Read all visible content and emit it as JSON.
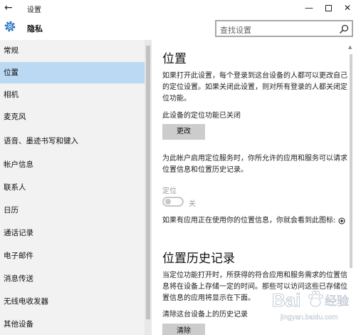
{
  "window": {
    "back_glyph": "←",
    "title": "设置",
    "minimize_glyph": "—",
    "close_glyph": "✕"
  },
  "header": {
    "title": "隐私",
    "search_placeholder": "查找设置"
  },
  "sidebar": {
    "items": [
      {
        "label": "常规",
        "selected": false
      },
      {
        "label": "位置",
        "selected": true
      },
      {
        "label": "相机",
        "selected": false
      },
      {
        "label": "麦克风",
        "selected": false
      },
      {
        "label": "语音、墨迹书写和键入",
        "selected": false
      },
      {
        "label": "帐户信息",
        "selected": false
      },
      {
        "label": "联系人",
        "selected": false
      },
      {
        "label": "日历",
        "selected": false
      },
      {
        "label": "通话记录",
        "selected": false
      },
      {
        "label": "电子邮件",
        "selected": false
      },
      {
        "label": "消息传送",
        "selected": false
      },
      {
        "label": "无线电收发器",
        "selected": false
      },
      {
        "label": "其他设备",
        "selected": false
      }
    ]
  },
  "main": {
    "location": {
      "title": "位置",
      "description": "如果打开此设置，每个登录到这台设备的人都可以更改自己的定位设置。如果关闭此设置，则对所有登录的人都关闭定位功能。",
      "device_status": "此设备的定位功能已关闭",
      "change_button": "更改",
      "account_description": "为此帐户启用定位服务时，你所允许的应用和服务可以请求位置信息和位置历史记录。",
      "toggle_label": "定位",
      "toggle_state": "关",
      "toggle_on": false,
      "icon_note": "如果有应用正在使用你的位置信息，你就会看到此图标:"
    },
    "history": {
      "title": "位置历史记录",
      "description": "当定位功能打开时，所获得的符合应用和服务需求的位置信息将在设备上存储一定的时间。那些可以访问这些已存储位置信息的应用将显示在下面。",
      "clear_label": "清除这台设备上的历史记录",
      "clear_button": "清除"
    }
  },
  "watermark": {
    "brand": "Bai",
    "brand2": "经验",
    "sub": "jingyan.baidu.com"
  },
  "colors": {
    "selected_item": "#bcd9f4",
    "sidebar_bg": "#f2f2f2",
    "button_bg": "#cccccc"
  }
}
